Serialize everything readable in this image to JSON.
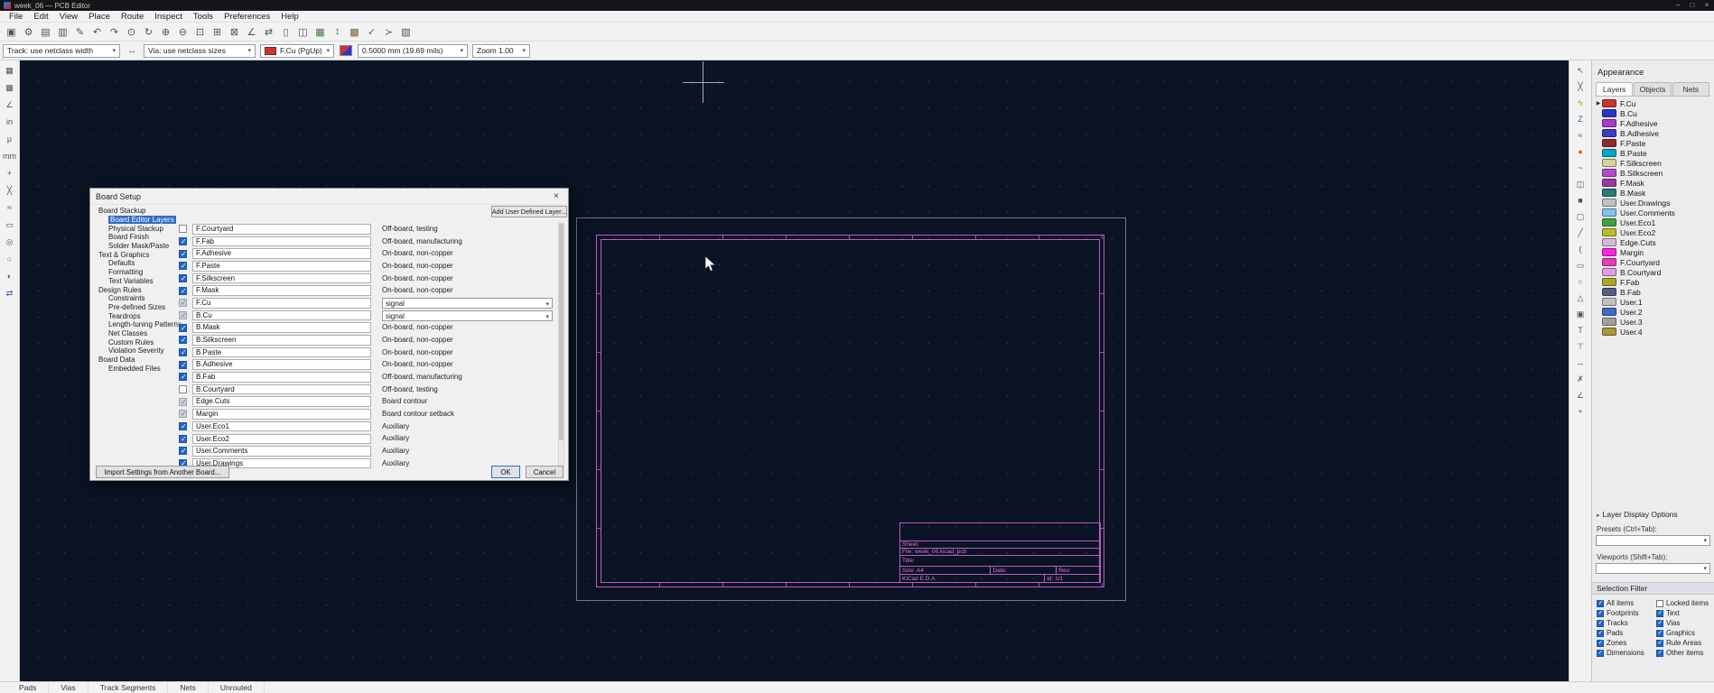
{
  "window": {
    "title": "week_06 — PCB Editor",
    "controls": {
      "minimize": "–",
      "maximize": "□",
      "close": "×"
    }
  },
  "glyphs": {
    "chevron_down": "▾",
    "caret_right": "▸"
  },
  "menubar": {
    "items": [
      "File",
      "Edit",
      "View",
      "Place",
      "Route",
      "Inspect",
      "Tools",
      "Preferences",
      "Help"
    ]
  },
  "toolbar_main": {
    "icons": [
      {
        "name": "save-icon",
        "glyph": "▣"
      },
      {
        "name": "board-setup-icon",
        "glyph": "⚙"
      },
      {
        "name": "page-settings-icon",
        "glyph": "▤"
      },
      {
        "name": "print-icon",
        "glyph": "▥"
      },
      {
        "name": "plot-icon",
        "glyph": "✎"
      },
      {
        "name": "undo-icon",
        "glyph": "↶"
      },
      {
        "name": "redo-icon",
        "glyph": "↷"
      },
      {
        "name": "find-icon",
        "glyph": "⊙"
      },
      {
        "name": "refresh-view-icon",
        "glyph": "↻"
      },
      {
        "name": "zoom-in-icon",
        "glyph": "⊕"
      },
      {
        "name": "zoom-out-icon",
        "glyph": "⊖"
      },
      {
        "name": "zoom-fit-page-icon",
        "glyph": "⊡"
      },
      {
        "name": "zoom-fit-objects-icon",
        "glyph": "⊞"
      },
      {
        "name": "zoom-selection-icon",
        "glyph": "⊠"
      },
      {
        "name": "track-posture-icon",
        "glyph": "∠"
      },
      {
        "name": "mirror-icon",
        "glyph": "⇄"
      },
      {
        "name": "lock-icon",
        "glyph": "▯"
      },
      {
        "name": "group-icon",
        "glyph": "◫"
      },
      {
        "name": "footprint-editor-icon",
        "glyph": "▦",
        "color": "#3c7a3c"
      },
      {
        "name": "update-pcb-from-schematic-icon",
        "glyph": "↕",
        "color": "#3465a4"
      },
      {
        "name": "3d-viewer-icon",
        "glyph": "▩",
        "color": "#7a5c3c"
      },
      {
        "name": "drc-icon",
        "glyph": "✓",
        "color": "#3c7a3c"
      },
      {
        "name": "script-console-icon",
        "glyph": "≻",
        "color": "#3465a4"
      },
      {
        "name": "layer-display-icon",
        "glyph": "▧"
      }
    ]
  },
  "toolbar_drawing": {
    "track_width": "Track: use netclass width",
    "via_size": "Via: use netclass sizes",
    "active_layer": "F.Cu (PgUp)",
    "active_layer_color": "#C83434",
    "grid": "0.5000 mm (19.69 mils)",
    "zoom": "Zoom 1.00"
  },
  "left_toolbar": {
    "icons": [
      {
        "name": "grid-toggle-icon",
        "glyph": "▦"
      },
      {
        "name": "grid-override-icon",
        "glyph": "▩"
      },
      {
        "name": "polar-coords-icon",
        "glyph": "∠"
      },
      {
        "name": "units-inch-icon",
        "glyph": "in"
      },
      {
        "name": "units-mil-icon",
        "glyph": "µ"
      },
      {
        "name": "units-mm-icon",
        "glyph": "mm"
      },
      {
        "name": "crosshair-cursor-icon",
        "glyph": "+"
      },
      {
        "name": "ratsnest-toggle-icon",
        "glyph": "╳"
      },
      {
        "name": "curved-ratsnest-icon",
        "glyph": "≈"
      },
      {
        "name": "track-outline-mode-icon",
        "glyph": "▭"
      },
      {
        "name": "via-outline-mode-icon",
        "glyph": "◎"
      },
      {
        "name": "pad-outline-mode-icon",
        "glyph": "○"
      },
      {
        "name": "high-contrast-icon",
        "glyph": "◐"
      },
      {
        "name": "flip-board-icon",
        "glyph": "⇄",
        "color": "#3465a4"
      }
    ]
  },
  "right_toolbar": {
    "icons": [
      {
        "name": "select-tool-icon",
        "glyph": "↖"
      },
      {
        "name": "local-ratsnest-icon",
        "glyph": "╳"
      },
      {
        "name": "highlight-net-icon",
        "glyph": "ϟ",
        "color": "#b88a00"
      },
      {
        "name": "route-track-icon",
        "glyph": "Z",
        "color": "#3465a4"
      },
      {
        "name": "route-diff-pair-icon",
        "glyph": "≈"
      },
      {
        "name": "place-via-icon",
        "glyph": "●",
        "color": "#d2691e"
      },
      {
        "name": "tune-length-icon",
        "glyph": "~"
      },
      {
        "name": "place-footprint-icon",
        "glyph": "◫"
      },
      {
        "name": "draw-zone-icon",
        "glyph": "■"
      },
      {
        "name": "rule-area-icon",
        "glyph": "▢"
      },
      {
        "name": "draw-line-icon",
        "glyph": "╱"
      },
      {
        "name": "draw-arc-icon",
        "glyph": "("
      },
      {
        "name": "draw-rectangle-icon",
        "glyph": "▭"
      },
      {
        "name": "draw-circle-icon",
        "glyph": "○"
      },
      {
        "name": "draw-polygon-icon",
        "glyph": "△"
      },
      {
        "name": "reference-image-icon",
        "glyph": "▣"
      },
      {
        "name": "add-text-icon",
        "glyph": "T"
      },
      {
        "name": "text-box-icon",
        "glyph": "⊤"
      },
      {
        "name": "dimension-icon",
        "glyph": "↔"
      },
      {
        "name": "delete-tool-icon",
        "glyph": "✗"
      },
      {
        "name": "measure-icon",
        "glyph": "∠"
      },
      {
        "name": "grid-origin-icon",
        "glyph": "+"
      }
    ]
  },
  "dialog": {
    "title": "Board Setup",
    "close_glyph": "×",
    "tree": [
      {
        "label": "Board Stackup",
        "cls": "lvl0"
      },
      {
        "label": "Board Editor Layers",
        "cls": "lvl1 selected"
      },
      {
        "label": "Physical Stackup",
        "cls": "lvl1"
      },
      {
        "label": "Board Finish",
        "cls": "lvl1"
      },
      {
        "label": "Solder Mask/Paste",
        "cls": "lvl1"
      },
      {
        "label": "Text & Graphics",
        "cls": "lvl0"
      },
      {
        "label": "Defaults",
        "cls": "lvl1"
      },
      {
        "label": "Formatting",
        "cls": "lvl1"
      },
      {
        "label": "Text Variables",
        "cls": "lvl1"
      },
      {
        "label": "Design Rules",
        "cls": "lvl0"
      },
      {
        "label": "Constraints",
        "cls": "lvl1"
      },
      {
        "label": "Pre-defined Sizes",
        "cls": "lvl1"
      },
      {
        "label": "Teardrops",
        "cls": "lvl1"
      },
      {
        "label": "Length-tuning Patterns",
        "cls": "lvl1"
      },
      {
        "label": "Net Classes",
        "cls": "lvl1"
      },
      {
        "label": "Custom Rules",
        "cls": "lvl1"
      },
      {
        "label": "Violation Severity",
        "cls": "lvl1"
      },
      {
        "label": "Board Data",
        "cls": "lvl0"
      },
      {
        "label": "Embedded Files",
        "cls": "lvl1"
      }
    ],
    "add_layer_button": "Add User Defined Layer...",
    "layers": [
      {
        "name": "F.Courtyard",
        "type": "Off-board, testing",
        "state": "unchecked",
        "control": "plain"
      },
      {
        "name": "F.Fab",
        "type": "Off-board, manufacturing",
        "state": "checked",
        "control": "plain"
      },
      {
        "name": "F.Adhesive",
        "type": "On-board, non-copper",
        "state": "checked",
        "control": "plain"
      },
      {
        "name": "F.Paste",
        "type": "On-board, non-copper",
        "state": "checked",
        "control": "plain"
      },
      {
        "name": "F.Silkscreen",
        "type": "On-board, non-copper",
        "state": "checked",
        "control": "plain"
      },
      {
        "name": "F.Mask",
        "type": "On-board, non-copper",
        "state": "checked",
        "control": "plain"
      },
      {
        "name": "F.Cu",
        "type": "signal",
        "state": "disabled",
        "control": "dropdown"
      },
      {
        "name": "B.Cu",
        "type": "signal",
        "state": "disabled",
        "control": "dropdown"
      },
      {
        "name": "B.Mask",
        "type": "On-board, non-copper",
        "state": "checked",
        "control": "plain"
      },
      {
        "name": "B.Silkscreen",
        "type": "On-board, non-copper",
        "state": "checked",
        "control": "plain"
      },
      {
        "name": "B.Paste",
        "type": "On-board, non-copper",
        "state": "checked",
        "control": "plain"
      },
      {
        "name": "B.Adhesive",
        "type": "On-board, non-copper",
        "state": "checked",
        "control": "plain"
      },
      {
        "name": "B.Fab",
        "type": "Off-board, manufacturing",
        "state": "checked",
        "control": "plain"
      },
      {
        "name": "B.Courtyard",
        "type": "Off-board, testing",
        "state": "unchecked",
        "control": "plain"
      },
      {
        "name": "Edge.Cuts",
        "type": "Board contour",
        "state": "disabled",
        "control": "plain"
      },
      {
        "name": "Margin",
        "type": "Board contour setback",
        "state": "disabled",
        "control": "plain"
      },
      {
        "name": "User.Eco1",
        "type": "Auxiliary",
        "state": "checked",
        "control": "plain"
      },
      {
        "name": "User.Eco2",
        "type": "Auxiliary",
        "state": "checked",
        "control": "plain"
      },
      {
        "name": "User.Comments",
        "type": "Auxiliary",
        "state": "checked",
        "control": "plain"
      },
      {
        "name": "User.Drawings",
        "type": "Auxiliary",
        "state": "checked",
        "control": "plain"
      }
    ],
    "import_button": "Import Settings from Another Board...",
    "ok": "OK",
    "cancel": "Cancel"
  },
  "canvas": {
    "title_block": {
      "sheet": "Sheet:",
      "file": "File: week_06.kicad_pcb",
      "title": "Title:",
      "size": "Size: A4",
      "date": "Date:",
      "rev": "Rev:",
      "software": "KiCad E.D.A.",
      "id": "Id: 1/1"
    }
  },
  "appearance": {
    "title": "Appearance",
    "tabs": [
      {
        "label": "Layers",
        "cls": "active"
      },
      {
        "label": "Objects",
        "cls": ""
      },
      {
        "label": "Nets",
        "cls": ""
      }
    ],
    "layers": [
      {
        "name": "F.Cu",
        "color": "#C83434",
        "state": "active"
      },
      {
        "name": "B.Cu",
        "color": "#2437C8",
        "state": ""
      },
      {
        "name": "F.Adhesive",
        "color": "#A83BC8",
        "state": ""
      },
      {
        "name": "B.Adhesive",
        "color": "#3B3BC3",
        "state": ""
      },
      {
        "name": "F.Paste",
        "color": "#8F2B2B",
        "state": ""
      },
      {
        "name": "B.Paste",
        "color": "#00A8C8",
        "state": ""
      },
      {
        "name": "F.Silkscreen",
        "color": "#D8CEA1",
        "state": ""
      },
      {
        "name": "B.Silkscreen",
        "color": "#B44BC8",
        "state": ""
      },
      {
        "name": "F.Mask",
        "color": "#9A3AA0",
        "state": ""
      },
      {
        "name": "B.Mask",
        "color": "#2A7A72",
        "state": ""
      },
      {
        "name": "User.Drawings",
        "color": "#C2C2C2",
        "state": ""
      },
      {
        "name": "User.Comments",
        "color": "#89C2E8",
        "state": ""
      },
      {
        "name": "User.Eco1",
        "color": "#3FA43F",
        "state": ""
      },
      {
        "name": "User.Eco2",
        "color": "#BCBC2A",
        "state": ""
      },
      {
        "name": "Edge.Cuts",
        "color": "#D8B8D8",
        "state": ""
      },
      {
        "name": "Margin",
        "color": "#FF26E2",
        "state": ""
      },
      {
        "name": "F.Courtyard",
        "color": "#E93CB8",
        "state": ""
      },
      {
        "name": "B.Courtyard",
        "color": "#DE9FDE",
        "state": ""
      },
      {
        "name": "F.Fab",
        "color": "#A8A82A",
        "state": ""
      },
      {
        "name": "B.Fab",
        "color": "#585D84",
        "state": ""
      },
      {
        "name": "User.1",
        "color": "#C2C2C2",
        "state": ""
      },
      {
        "name": "User.2",
        "color": "#4268C8",
        "state": ""
      },
      {
        "name": "User.3",
        "color": "#A0A0A0",
        "state": ""
      },
      {
        "name": "User.4",
        "color": "#A89838",
        "state": ""
      }
    ],
    "layer_display_options": "Layer Display Options",
    "presets_label": "Presets (Ctrl+Tab):",
    "presets_value": "",
    "viewports_label": "Viewports (Shift+Tab):",
    "viewports_value": "",
    "selection_filter": {
      "title": "Selection Filter",
      "items": [
        {
          "label": "All items",
          "state": "checked"
        },
        {
          "label": "Locked items",
          "state": "unchecked"
        },
        {
          "label": "Footprints",
          "state": "checked"
        },
        {
          "label": "Text",
          "state": "checked"
        },
        {
          "label": "Tracks",
          "state": "checked"
        },
        {
          "label": "Vias",
          "state": "checked"
        },
        {
          "label": "Pads",
          "state": "checked"
        },
        {
          "label": "Graphics",
          "state": "checked"
        },
        {
          "label": "Zones",
          "state": "checked"
        },
        {
          "label": "Rule Areas",
          "state": "checked"
        },
        {
          "label": "Dimensions",
          "state": "checked"
        },
        {
          "label": "Other items",
          "state": "checked"
        }
      ]
    }
  },
  "status_bar": {
    "items": [
      "Pads",
      "Vias",
      "Track Segments",
      "Nets",
      "Unrouted"
    ]
  }
}
